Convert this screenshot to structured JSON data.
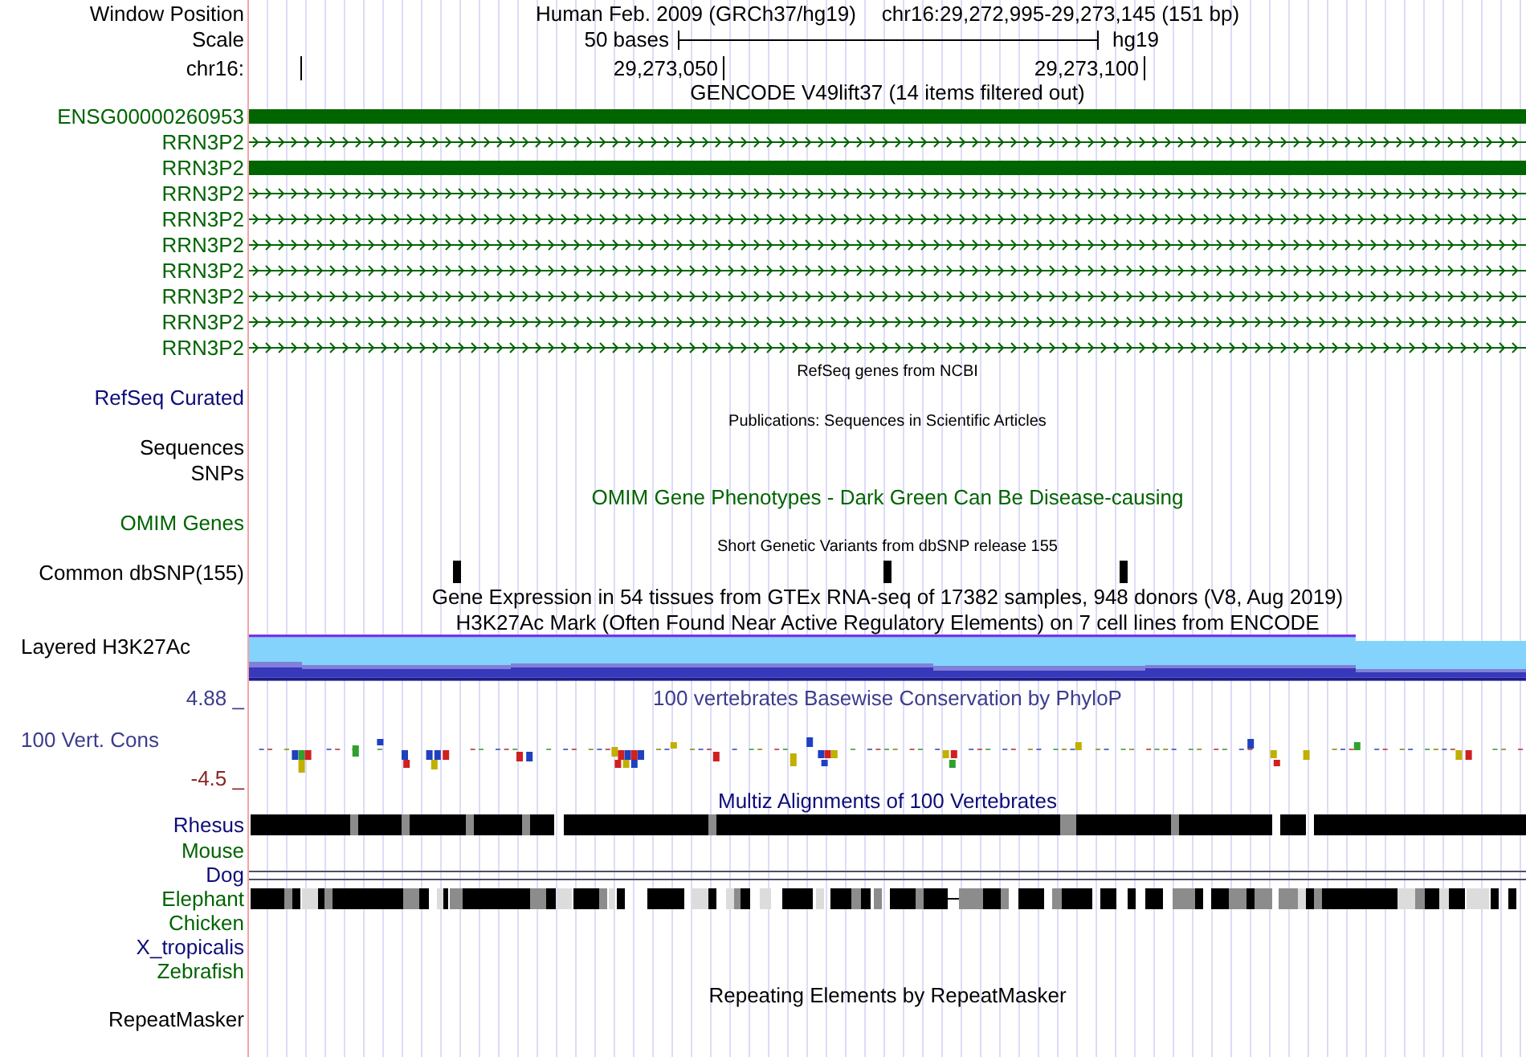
{
  "window_position": {
    "label": "Window Position",
    "assembly": "Human Feb. 2009 (GRCh37/hg19)",
    "position": "chr16:29,272,995-29,273,145 (151 bp)"
  },
  "scale": {
    "label": "Scale",
    "span": "50 bases",
    "assembly": "hg19"
  },
  "ruler": {
    "label": "chr16:",
    "ticks": [
      "29,273,050",
      "29,273,100"
    ]
  },
  "gencode": {
    "title": "GENCODE V49lift37 (14 items filtered out)",
    "items": [
      {
        "label": "ENSG00000260953",
        "kind": "block"
      },
      {
        "label": "RRN3P2",
        "kind": "arrows"
      },
      {
        "label": "RRN3P2",
        "kind": "block"
      },
      {
        "label": "RRN3P2",
        "kind": "arrows"
      },
      {
        "label": "RRN3P2",
        "kind": "arrows"
      },
      {
        "label": "RRN3P2",
        "kind": "arrows"
      },
      {
        "label": "RRN3P2",
        "kind": "arrows"
      },
      {
        "label": "RRN3P2",
        "kind": "arrows"
      },
      {
        "label": "RRN3P2",
        "kind": "arrows"
      },
      {
        "label": "RRN3P2",
        "kind": "arrows"
      }
    ]
  },
  "refseq": {
    "title": "RefSeq genes from NCBI",
    "label": "RefSeq Curated"
  },
  "publications": {
    "title": "Publications: Sequences in Scientific Articles",
    "labels": [
      "Sequences",
      "SNPs"
    ]
  },
  "omim": {
    "title": "OMIM Gene Phenotypes - Dark Green Can Be Disease-causing",
    "label": "OMIM Genes"
  },
  "dbsnp": {
    "title": "Short Genetic Variants from dbSNP release 155",
    "label": "Common dbSNP(155)"
  },
  "gtex": {
    "title": "Gene Expression in 54 tissues from GTEx RNA-seq of 17382 samples, 948 donors (V8, Aug 2019)"
  },
  "h3k27ac": {
    "title": "H3K27Ac Mark (Often Found Near Active Regulatory Elements) on 7 cell lines from ENCODE",
    "label": "Layered H3K27Ac"
  },
  "conservation": {
    "title": "100 vertebrates Basewise Conservation by PhyloP",
    "label": "100 Vert. Cons",
    "axis_max": "4.88 _",
    "axis_min": "-4.5 _"
  },
  "multiz": {
    "title": "Multiz Alignments of 100 Vertebrates",
    "species": [
      {
        "name": "Rhesus",
        "color": "#0c0c78",
        "kind": "blocks"
      },
      {
        "name": "Mouse",
        "color": "#006400",
        "kind": "none"
      },
      {
        "name": "Dog",
        "color": "#0c0c78",
        "kind": "double-line"
      },
      {
        "name": "Elephant",
        "color": "#006400",
        "kind": "blocks"
      },
      {
        "name": "Chicken",
        "color": "#006400",
        "kind": "none"
      },
      {
        "name": "X_tropicalis",
        "color": "#0c0c78",
        "kind": "none"
      },
      {
        "name": "Zebrafish",
        "color": "#006400",
        "kind": "none"
      }
    ]
  },
  "repeatmasker": {
    "title": "Repeating Elements by RepeatMasker",
    "label": "RepeatMasker"
  }
}
